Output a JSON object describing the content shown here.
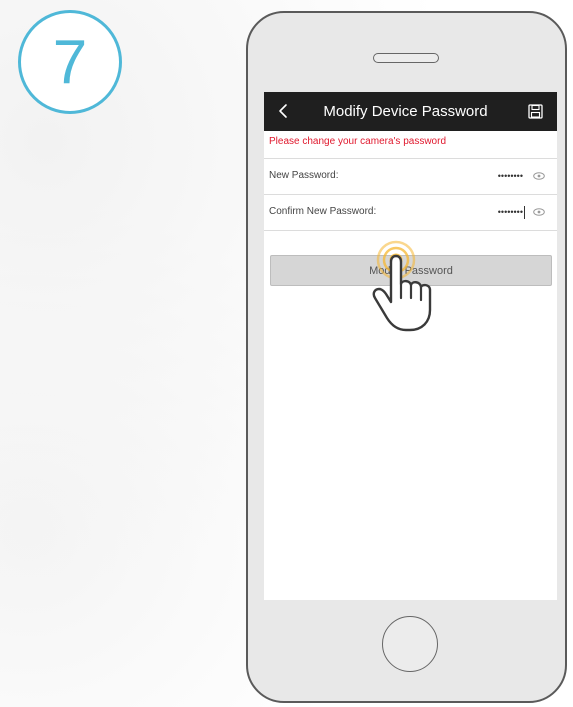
{
  "step": {
    "number": "7"
  },
  "colors": {
    "accent": "#4fb8d8",
    "title_bar": "#1f1f1f",
    "warning": "#e0182d",
    "button": "#d6d6d6",
    "tap_highlight": "#f5b731"
  },
  "header": {
    "title": "Modify Device Password",
    "back_icon": "chevron-left-icon",
    "save_icon": "save-icon"
  },
  "warning_text": "Please change your camera's password",
  "fields": [
    {
      "label": "New Password:",
      "value": "••••••••"
    },
    {
      "label": "Confirm New Password:",
      "value": "••••••••"
    }
  ],
  "button": {
    "label": "Modify Password"
  }
}
